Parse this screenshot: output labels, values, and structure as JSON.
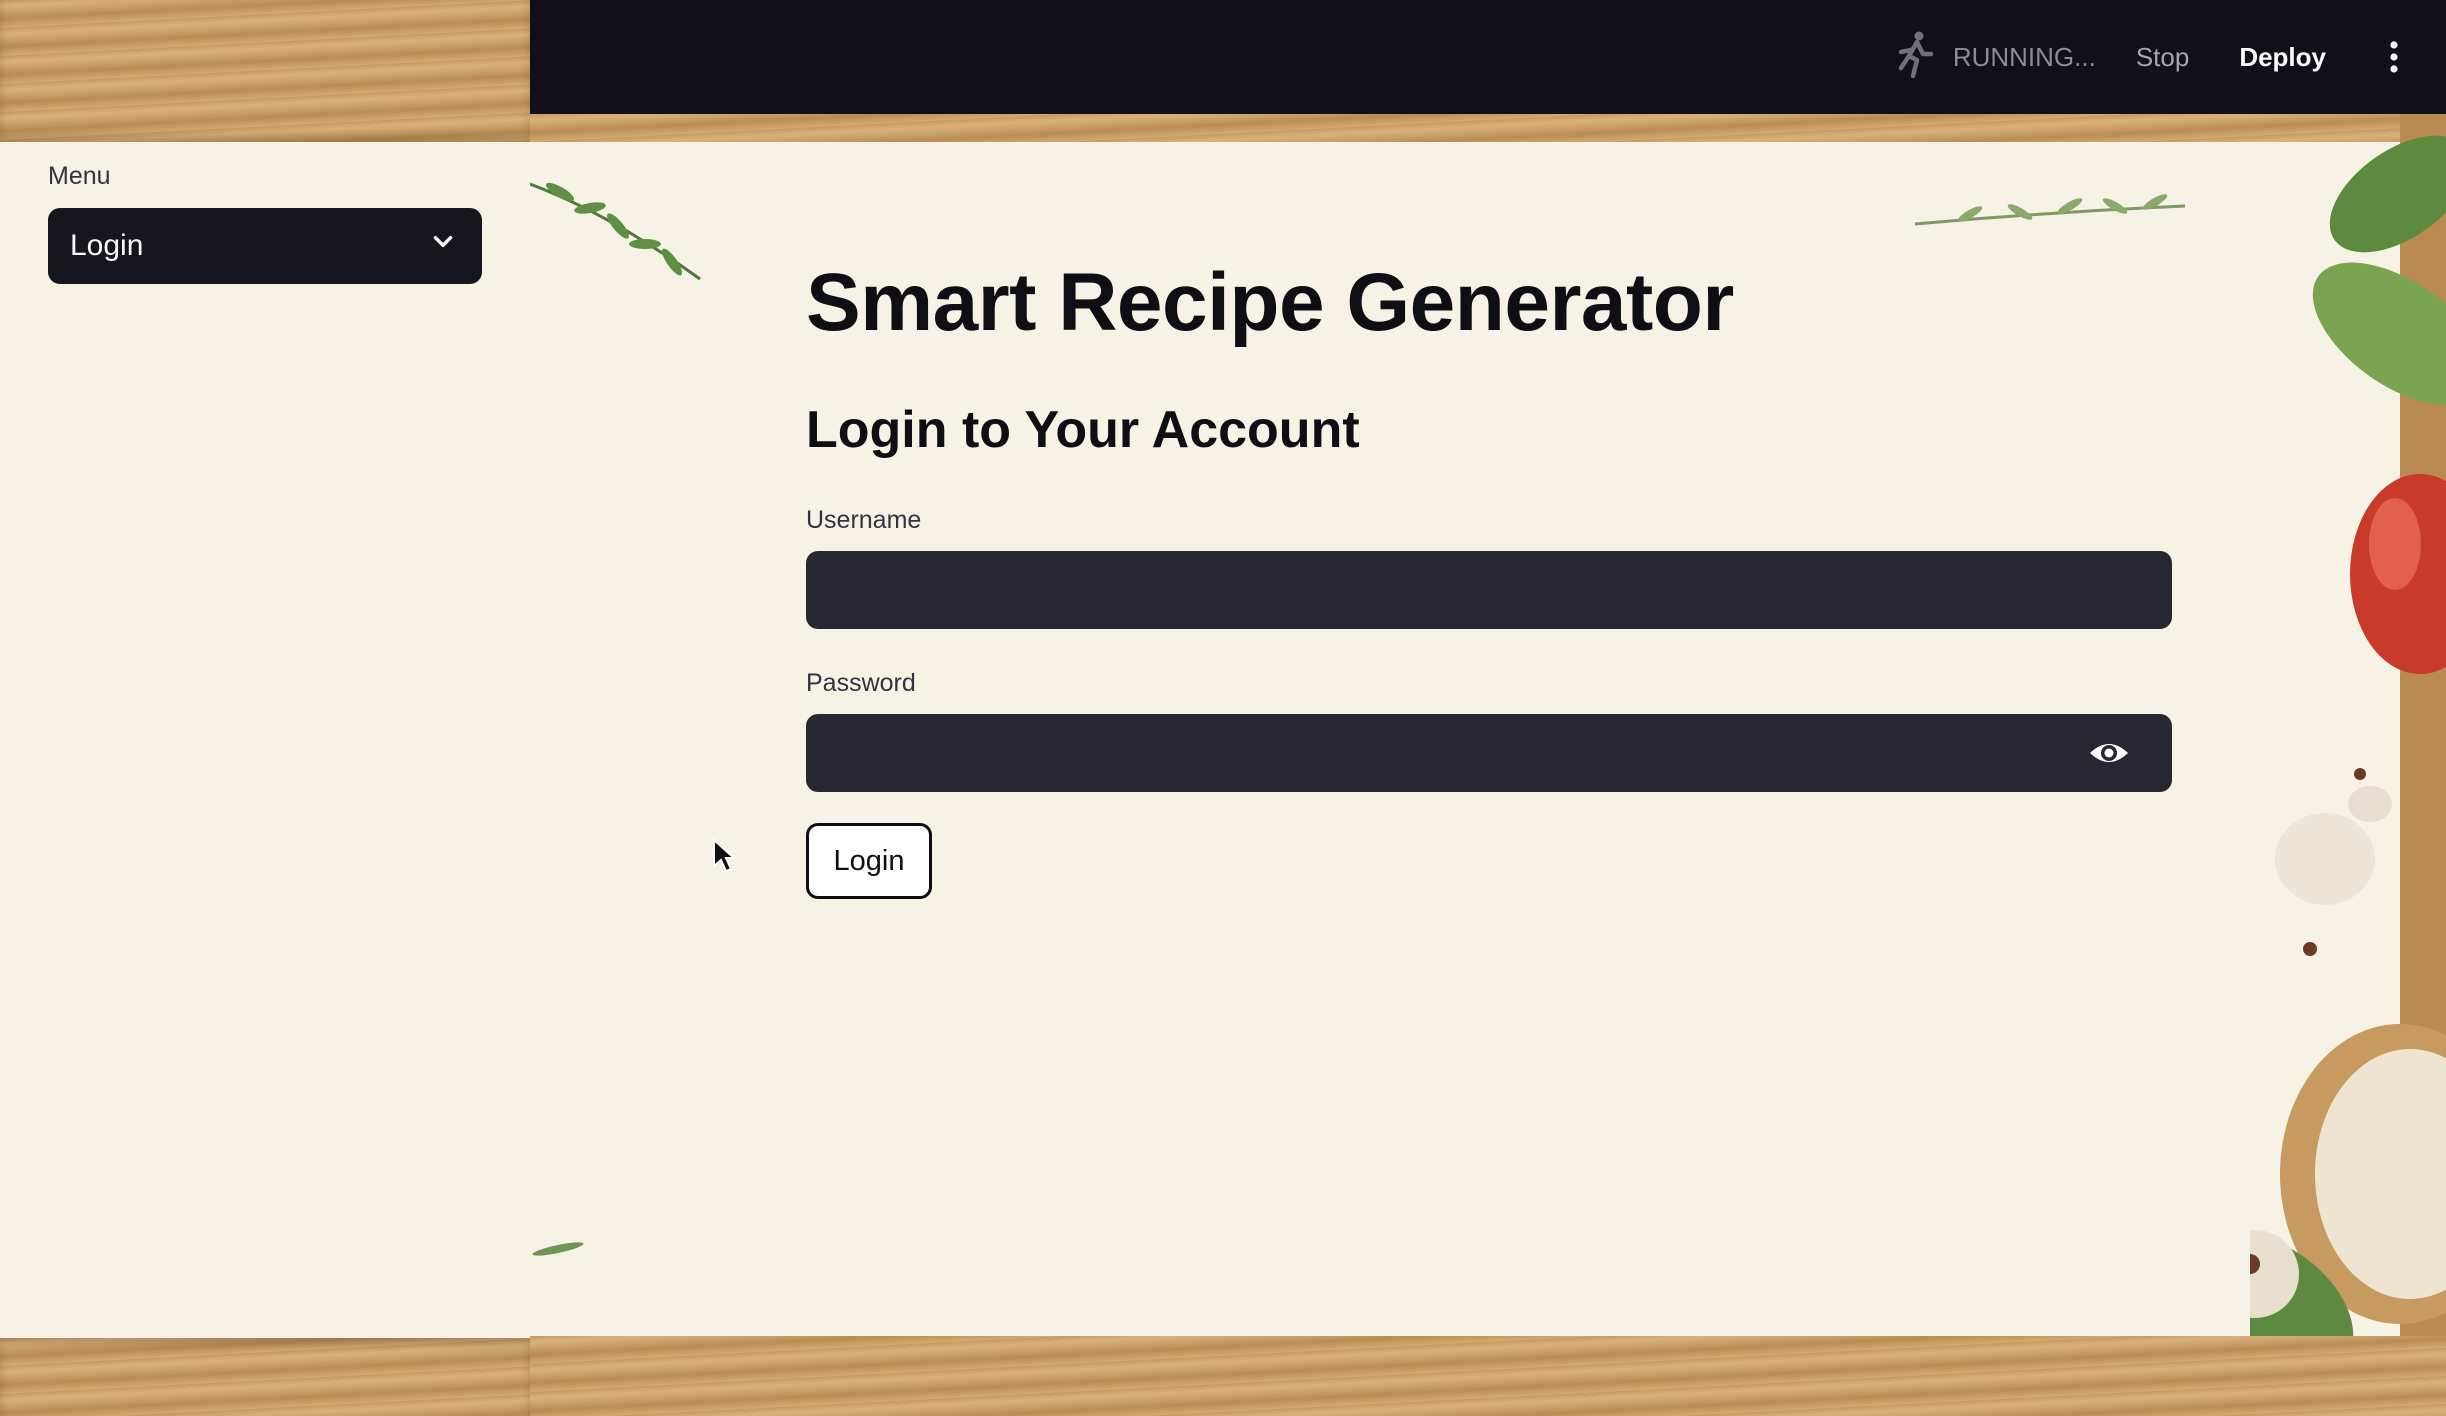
{
  "sidebar": {
    "menu_label": "Menu",
    "selected": "Login"
  },
  "header": {
    "status": "RUNNING...",
    "stop_label": "Stop",
    "deploy_label": "Deploy"
  },
  "main": {
    "title": "Smart Recipe Generator",
    "subtitle": "Login to Your Account",
    "username_label": "Username",
    "username_value": "",
    "password_label": "Password",
    "password_value": "",
    "login_button": "Login"
  },
  "colors": {
    "header_bg": "#0e1117",
    "page_bg": "#f6f3e6",
    "input_bg": "#262730",
    "select_bg": "#15161e",
    "text_dark": "#0e0e14",
    "wood": "#c59a62"
  },
  "icons": {
    "select": "chevron-down-icon",
    "status": "running-figure-icon",
    "menu": "kebab-menu-icon",
    "password_toggle": "eye-icon"
  }
}
